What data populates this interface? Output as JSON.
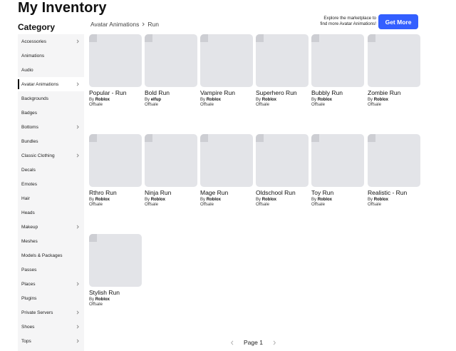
{
  "header": {
    "title": "My Inventory"
  },
  "sidebar": {
    "title": "Category",
    "items": [
      {
        "label": "Accessories",
        "chevron": true,
        "active": false
      },
      {
        "label": "Animations",
        "chevron": false,
        "active": false
      },
      {
        "label": "Audio",
        "chevron": false,
        "active": false
      },
      {
        "label": "Avatar Animations",
        "chevron": true,
        "active": true
      },
      {
        "label": "Backgrounds",
        "chevron": false,
        "active": false
      },
      {
        "label": "Badges",
        "chevron": false,
        "active": false
      },
      {
        "label": "Bottoms",
        "chevron": true,
        "active": false
      },
      {
        "label": "Bundles",
        "chevron": false,
        "active": false
      },
      {
        "label": "Classic Clothing",
        "chevron": true,
        "active": false
      },
      {
        "label": "Decals",
        "chevron": false,
        "active": false
      },
      {
        "label": "Emotes",
        "chevron": false,
        "active": false
      },
      {
        "label": "Hair",
        "chevron": false,
        "active": false
      },
      {
        "label": "Heads",
        "chevron": false,
        "active": false
      },
      {
        "label": "Makeup",
        "chevron": true,
        "active": false
      },
      {
        "label": "Meshes",
        "chevron": false,
        "active": false
      },
      {
        "label": "Models & Packages",
        "chevron": false,
        "active": false
      },
      {
        "label": "Passes",
        "chevron": false,
        "active": false
      },
      {
        "label": "Places",
        "chevron": true,
        "active": false
      },
      {
        "label": "Plugins",
        "chevron": false,
        "active": false
      },
      {
        "label": "Private Servers",
        "chevron": true,
        "active": false
      },
      {
        "label": "Shoes",
        "chevron": true,
        "active": false
      },
      {
        "label": "Tops",
        "chevron": true,
        "active": false
      }
    ]
  },
  "breadcrumb": {
    "parent": "Avatar Animations",
    "current": "Run"
  },
  "promo": {
    "line1": "Explore the marketplace to",
    "line2": "find more Avatar Animations!",
    "button": "Get More"
  },
  "items": [
    {
      "name": "Popular - Run",
      "by": "By",
      "creator": "Roblox",
      "price": "Offsale"
    },
    {
      "name": "Bold Run",
      "by": "By",
      "creator": "elfup",
      "price": "Offsale"
    },
    {
      "name": "Vampire Run",
      "by": "By",
      "creator": "Roblox",
      "price": "Offsale"
    },
    {
      "name": "Superhero Run",
      "by": "By",
      "creator": "Roblox",
      "price": "Offsale"
    },
    {
      "name": "Bubbly Run",
      "by": "By",
      "creator": "Roblox",
      "price": "Offsale"
    },
    {
      "name": "Zombie Run",
      "by": "By",
      "creator": "Roblox",
      "price": "Offsale"
    },
    {
      "name": "Rthro Run",
      "by": "By",
      "creator": "Roblox",
      "price": "Offsale"
    },
    {
      "name": "Ninja Run",
      "by": "By",
      "creator": "Roblox",
      "price": "Offsale"
    },
    {
      "name": "Mage Run",
      "by": "By",
      "creator": "Roblox",
      "price": "Offsale"
    },
    {
      "name": "Oldschool Run",
      "by": "By",
      "creator": "Roblox",
      "price": "Offsale"
    },
    {
      "name": "Toy Run",
      "by": "By",
      "creator": "Roblox",
      "price": "Offsale"
    },
    {
      "name": "Realistic - Run",
      "by": "By",
      "creator": "Roblox",
      "price": "Offsale"
    },
    {
      "name": "Stylish Run",
      "by": "By",
      "creator": "Roblox",
      "price": "Offsale"
    }
  ],
  "pagination": {
    "label": "Page 1"
  },
  "icons": {
    "chevron": "chevron-right-icon",
    "prev": "chevron-left-icon",
    "next": "chevron-right-icon"
  },
  "colors": {
    "accent": "#335fff",
    "sidebar_bg": "#f5f5f6",
    "thumb_bg": "#e3e4e8"
  }
}
